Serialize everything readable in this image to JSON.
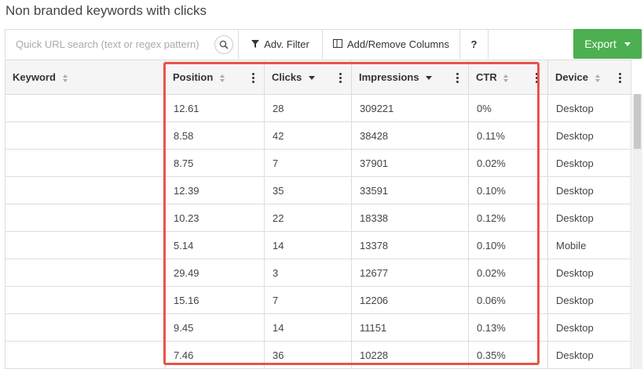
{
  "title": "Non branded keywords with clicks",
  "toolbar": {
    "search_placeholder": "Quick URL search (text or regex pattern)",
    "filter_label": "Adv. Filter",
    "columns_label": "Add/Remove Columns",
    "help_label": "?",
    "export_label": "Export"
  },
  "colors": {
    "export": "#4caf50",
    "highlight": "#e8534a"
  },
  "table": {
    "headers": [
      "Keyword",
      "Position",
      "Clicks",
      "Impressions",
      "CTR",
      "Device"
    ],
    "rows": [
      {
        "keyword": "",
        "position": "12.61",
        "clicks": "28",
        "impressions": "309221",
        "ctr": "0%",
        "device": "Desktop"
      },
      {
        "keyword": "",
        "position": "8.58",
        "clicks": "42",
        "impressions": "38428",
        "ctr": "0.11%",
        "device": "Desktop"
      },
      {
        "keyword": "",
        "position": "8.75",
        "clicks": "7",
        "impressions": "37901",
        "ctr": "0.02%",
        "device": "Desktop"
      },
      {
        "keyword": "",
        "position": "12.39",
        "clicks": "35",
        "impressions": "33591",
        "ctr": "0.10%",
        "device": "Desktop"
      },
      {
        "keyword": "",
        "position": "10.23",
        "clicks": "22",
        "impressions": "18338",
        "ctr": "0.12%",
        "device": "Desktop"
      },
      {
        "keyword": "",
        "position": "5.14",
        "clicks": "14",
        "impressions": "13378",
        "ctr": "0.10%",
        "device": "Mobile"
      },
      {
        "keyword": "",
        "position": "29.49",
        "clicks": "3",
        "impressions": "12677",
        "ctr": "0.02%",
        "device": "Desktop"
      },
      {
        "keyword": "",
        "position": "15.16",
        "clicks": "7",
        "impressions": "12206",
        "ctr": "0.06%",
        "device": "Desktop"
      },
      {
        "keyword": "",
        "position": "9.45",
        "clicks": "14",
        "impressions": "11151",
        "ctr": "0.13%",
        "device": "Desktop"
      },
      {
        "keyword": "",
        "position": "7.46",
        "clicks": "36",
        "impressions": "10228",
        "ctr": "0.35%",
        "device": "Desktop"
      }
    ]
  }
}
